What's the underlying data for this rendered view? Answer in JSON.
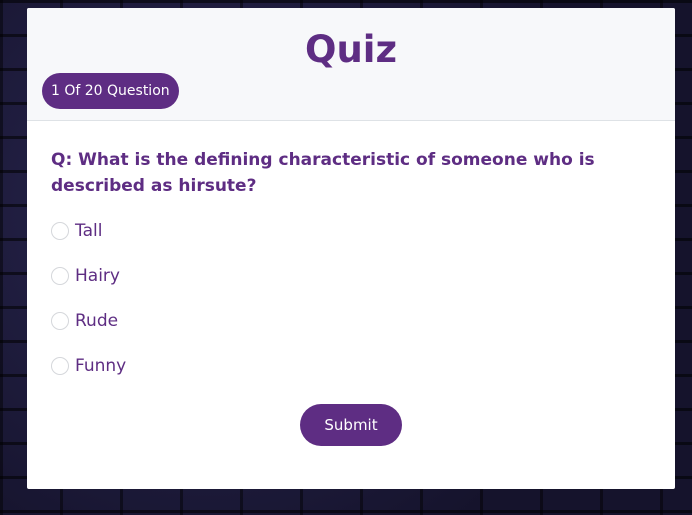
{
  "quiz": {
    "title": "Quiz",
    "progress": "1 Of 20 Question",
    "question": "Q: What is the defining characteristic of someone who is described as hirsute?",
    "options": [
      {
        "label": "Tall",
        "checked": false
      },
      {
        "label": "Hairy",
        "checked": false
      },
      {
        "label": "Rude",
        "checked": false
      },
      {
        "label": "Funny",
        "checked": false
      }
    ],
    "submit_label": "Submit"
  },
  "colors": {
    "accent": "#5e2d83",
    "header_bg": "#f7f8fa",
    "page_bg": "#15132c"
  }
}
